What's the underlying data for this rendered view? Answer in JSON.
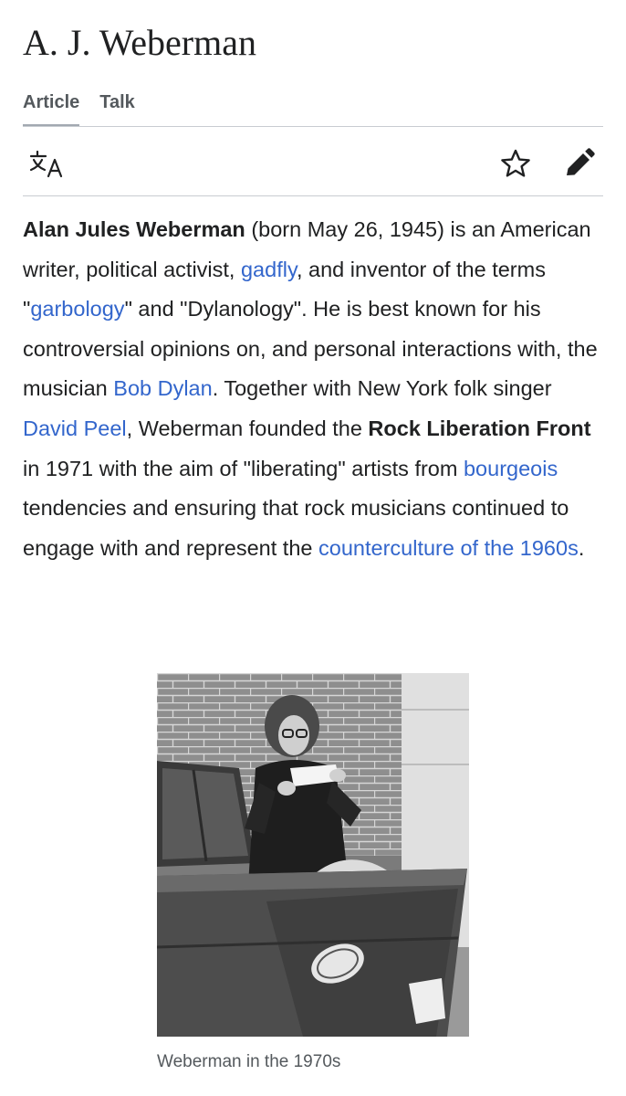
{
  "page": {
    "title": "A. J. Weberman"
  },
  "tabs": [
    {
      "label": "Article",
      "active": true
    },
    {
      "label": "Talk",
      "active": false
    }
  ],
  "toolbar": {
    "language_icon": "translate-icon",
    "watch_icon": "star-icon",
    "edit_icon": "pencil-icon"
  },
  "lead": {
    "name": "Alan Jules Weberman",
    "t1": " (born May 26, 1945) is an American writer, political activist, ",
    "link_gadfly": "gadfly",
    "t2": ", and inventor of the terms \"",
    "link_garbology": "garbology",
    "t3": "\" and \"Dylanology\". He is best known for his controversial opinions on, and personal interactions with, the musician ",
    "link_dylan": "Bob Dylan",
    "t4": ". Together with New York folk singer ",
    "link_peel": "David Peel",
    "t5": ", Weberman founded the ",
    "bold_rlf": "Rock Liberation Front",
    "t6": " in 1971 with the aim of \"liberating\" artists from ",
    "link_bourgeois": "bourgeois",
    "t7": " tendencies and ensuring that rock musicians continued to engage with and represent the ",
    "link_counterculture": "counterculture of the 1960s",
    "t8": "."
  },
  "figure": {
    "caption": "Weberman in the 1970s"
  },
  "colors": {
    "link": "#3366cc",
    "text": "#202122",
    "muted": "#54595d",
    "divider": "#c8ccd1"
  }
}
